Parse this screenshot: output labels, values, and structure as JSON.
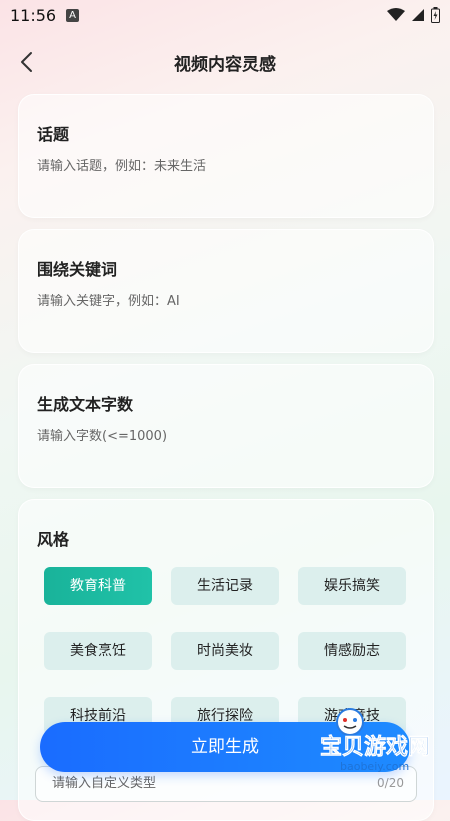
{
  "status": {
    "time": "11:56",
    "a_badge": "A"
  },
  "nav": {
    "title": "视频内容灵感"
  },
  "topic": {
    "title": "话题",
    "placeholder": "请输入话题，例如：未来生活"
  },
  "keywords": {
    "title": "围绕关键词",
    "placeholder": "请输入关键字，例如：AI"
  },
  "wordcount": {
    "title": "生成文本字数",
    "placeholder": "请输入字数(<=1000)"
  },
  "style": {
    "title": "风格",
    "options": [
      "教育科普",
      "生活记录",
      "娱乐搞笑",
      "美食烹饪",
      "时尚美妆",
      "情感励志",
      "科技前沿",
      "旅行探险",
      "游戏竞技"
    ],
    "selected": "教育科普",
    "custom_placeholder": "请输入自定义类型",
    "counter": "0/20"
  },
  "generate": {
    "label": "立即生成"
  },
  "watermark": {
    "text": "宝贝游戏网",
    "url": "baobeiy.com"
  },
  "colors": {
    "accent_teal": "#19b39a",
    "primary_blue": "#1a6cff",
    "chip_bg": "#dcefed"
  }
}
